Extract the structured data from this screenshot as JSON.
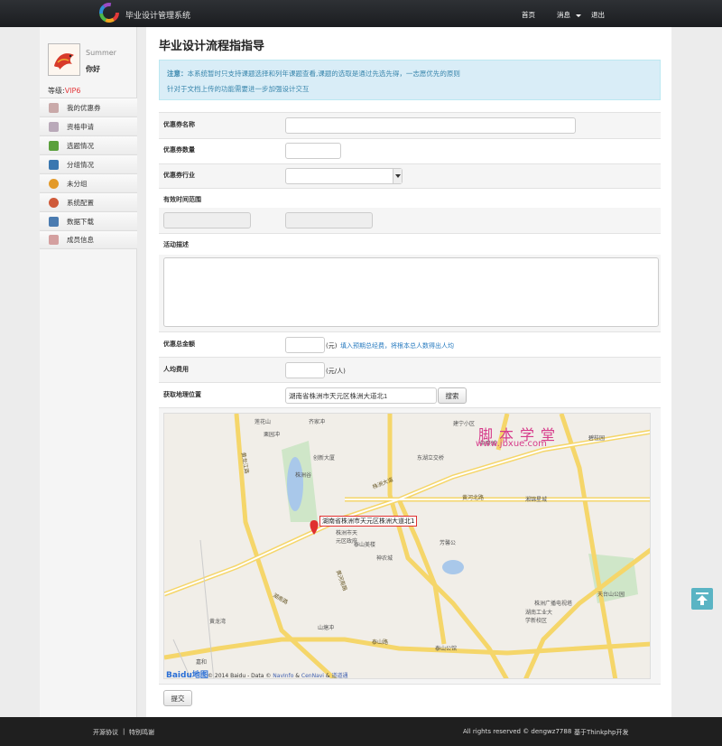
{
  "header": {
    "brand": "毕业设计管理系统",
    "nav": {
      "home": "首页",
      "messages": "消息",
      "logout": "退出"
    }
  },
  "user": {
    "name": "Summer",
    "greeting": "你好",
    "level_label": "等级:",
    "level_value": "VIP6"
  },
  "sidebar": {
    "items": [
      {
        "label": "我的优惠券",
        "icon": "coupon-icon",
        "color": "#c9a9a9"
      },
      {
        "label": "资格申请",
        "icon": "apply-icon",
        "color": "#b9a9b9"
      },
      {
        "label": "选题情况",
        "icon": "topic-icon",
        "color": "#5aa03c"
      },
      {
        "label": "分组情况",
        "icon": "group-icon",
        "color": "#3a77b0"
      },
      {
        "label": "未分组",
        "icon": "ungrouped-icon",
        "color": "#e39a2a"
      },
      {
        "label": "系统配置",
        "icon": "settings-icon",
        "color": "#cf5a3a"
      },
      {
        "label": "数据下载",
        "icon": "download-icon",
        "color": "#4a7bb0"
      },
      {
        "label": "成员信息",
        "icon": "members-icon",
        "color": "#d4a0a0"
      }
    ]
  },
  "page": {
    "title": "毕业设计流程指指导"
  },
  "alert": {
    "prefix": "注意：",
    "line1": "本系统暂时只支持课题选择和列年课题查看,课题的选取是通过先选先得，一志愿优先的原则",
    "line2": "针对于文档上传的功能需要进一步加强设计交互"
  },
  "form": {
    "coupon_name_label": "优惠券名称",
    "coupon_name_value": "",
    "coupon_qty_label": "优惠券数量",
    "coupon_qty_value": "",
    "industry_label": "优惠券行业",
    "industry_value": "",
    "valid_range_label": "有效时间范围",
    "description_label": "活动描述",
    "total_amount_label": "优惠总金额",
    "total_amount_unit": "(元)",
    "total_amount_hint": "填入预期总经费，将根本总人数得出人均",
    "per_person_label": "人均费用",
    "per_person_unit": "(元/人)",
    "location_label": "获取地理位置",
    "location_value": "湖南省株洲市天元区株洲大道北1",
    "search_button": "搜索",
    "submit_button": "提交"
  },
  "map": {
    "address_tag": "湖南省株洲市天元区株洲大道北1",
    "watermark_cn": "脚本学堂",
    "watermark_url": "www.jbxue.com",
    "baidu_logo": "Baidu地图",
    "copyright_prefix": "© 2014 Baidu - Data ©",
    "copyright_link1": "NavInfo",
    "copyright_amp": "&",
    "copyright_link2": "CenNavi",
    "copyright_link3": "道道通",
    "places": [
      "莲花山",
      "齐家冲",
      "建宁小区",
      "碧桂园",
      "中豪城",
      "东湖立交桥",
      "创新大厦",
      "栗园冲",
      "株洲谷",
      "黄龙江路",
      "株洲大道",
      "黄河北路",
      "湘锦星城",
      "株洲市天元区政府",
      "泰山美楼",
      "神农城",
      "芳馨公",
      "泰山路",
      "黄河南路",
      "湖南工业大学新校区",
      "天台山公园",
      "泰山公馆",
      "山塘冲",
      "株洲广播电视塔",
      "嘉和",
      "湖南路",
      "黄龙湾"
    ]
  },
  "footer": {
    "link1": "开源协议",
    "sep": "|",
    "link2": "特别鸣谢",
    "rights": "All rights reserved © dengwz7788",
    "powered": "基于Thinkphp开发"
  }
}
